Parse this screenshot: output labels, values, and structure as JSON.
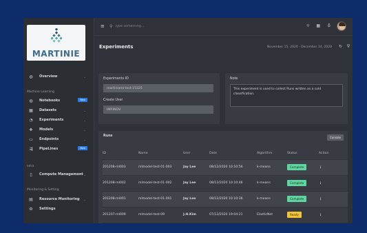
{
  "brand": {
    "name": "MARTINIE",
    "mark_color": "#3f6b8a"
  },
  "sidebar": {
    "overview": "Overview",
    "sections": [
      {
        "title": "Machine Learning"
      },
      {
        "title": "Infra"
      },
      {
        "title": "Monitoring & Setting"
      }
    ],
    "ml_items": [
      {
        "label": "Notebooks",
        "icon": "globe-icon",
        "badge": "New"
      },
      {
        "label": "Datasets",
        "icon": "grid-icon"
      },
      {
        "label": "Experiments",
        "icon": "flask-icon"
      },
      {
        "label": "Models",
        "icon": "cube-icon"
      },
      {
        "label": "Endpoints",
        "icon": "window-icon"
      },
      {
        "label": "PipeLines",
        "icon": "pipeline-icon",
        "badge": "New"
      }
    ],
    "infra_items": [
      {
        "label": "Compute Management",
        "icon": "server-icon"
      }
    ],
    "monitor_items": [
      {
        "label": "Resource Monitoring",
        "icon": "file-icon"
      },
      {
        "label": "Settings",
        "icon": "gear-icon"
      }
    ]
  },
  "topbar": {
    "search_placeholder": "Type something..."
  },
  "page": {
    "title": "Experiments",
    "date_range": "November 15, 2020 - December 14, 2020"
  },
  "experiment": {
    "id_label": "Experiments ID",
    "id_value": "martinieml-test-15325",
    "user_label": "Create User",
    "user_value": "IMP.INOV",
    "note_label": "Note",
    "note_value": "This experiment is used to collect Runs written as a cold classification."
  },
  "runs": {
    "title": "Runs",
    "console_label": "Console",
    "columns": [
      "ID",
      "Name",
      "User",
      "Date",
      "Algorithm",
      "Status",
      "Action"
    ],
    "rows": [
      {
        "id": "201208-ml003",
        "name": "mlmodel-test-01-003",
        "user": "Jay Lee",
        "date": "08/12/2020 10:10:56",
        "algorithm": "k-means",
        "status": "Complete"
      },
      {
        "id": "201208-ml002",
        "name": "mlmodel-test-01-002",
        "user": "Jay Lee",
        "date": "08/12/2020 10:10:46",
        "algorithm": "k-means",
        "status": "Complete"
      },
      {
        "id": "201208-ml001",
        "name": "mlmodel-test-01-001",
        "user": "Jay Lee",
        "date": "08/12/2020 10:10:36",
        "algorithm": "k-means",
        "status": "Complete"
      },
      {
        "id": "201207-ml009",
        "name": "mlmodel-test-09",
        "user": "J.H.Kim",
        "date": "07/12/2020 19:04:21",
        "algorithm": "ElasticNet",
        "status": "Ready"
      }
    ],
    "action_symbol": "⋮"
  },
  "colors": {
    "background": "#0e2c6a",
    "panel": "#2f3238",
    "complete": "#5fd6a1",
    "ready": "#f3c43a",
    "badge": "#2d7be5",
    "failed": "#d94a4a"
  }
}
